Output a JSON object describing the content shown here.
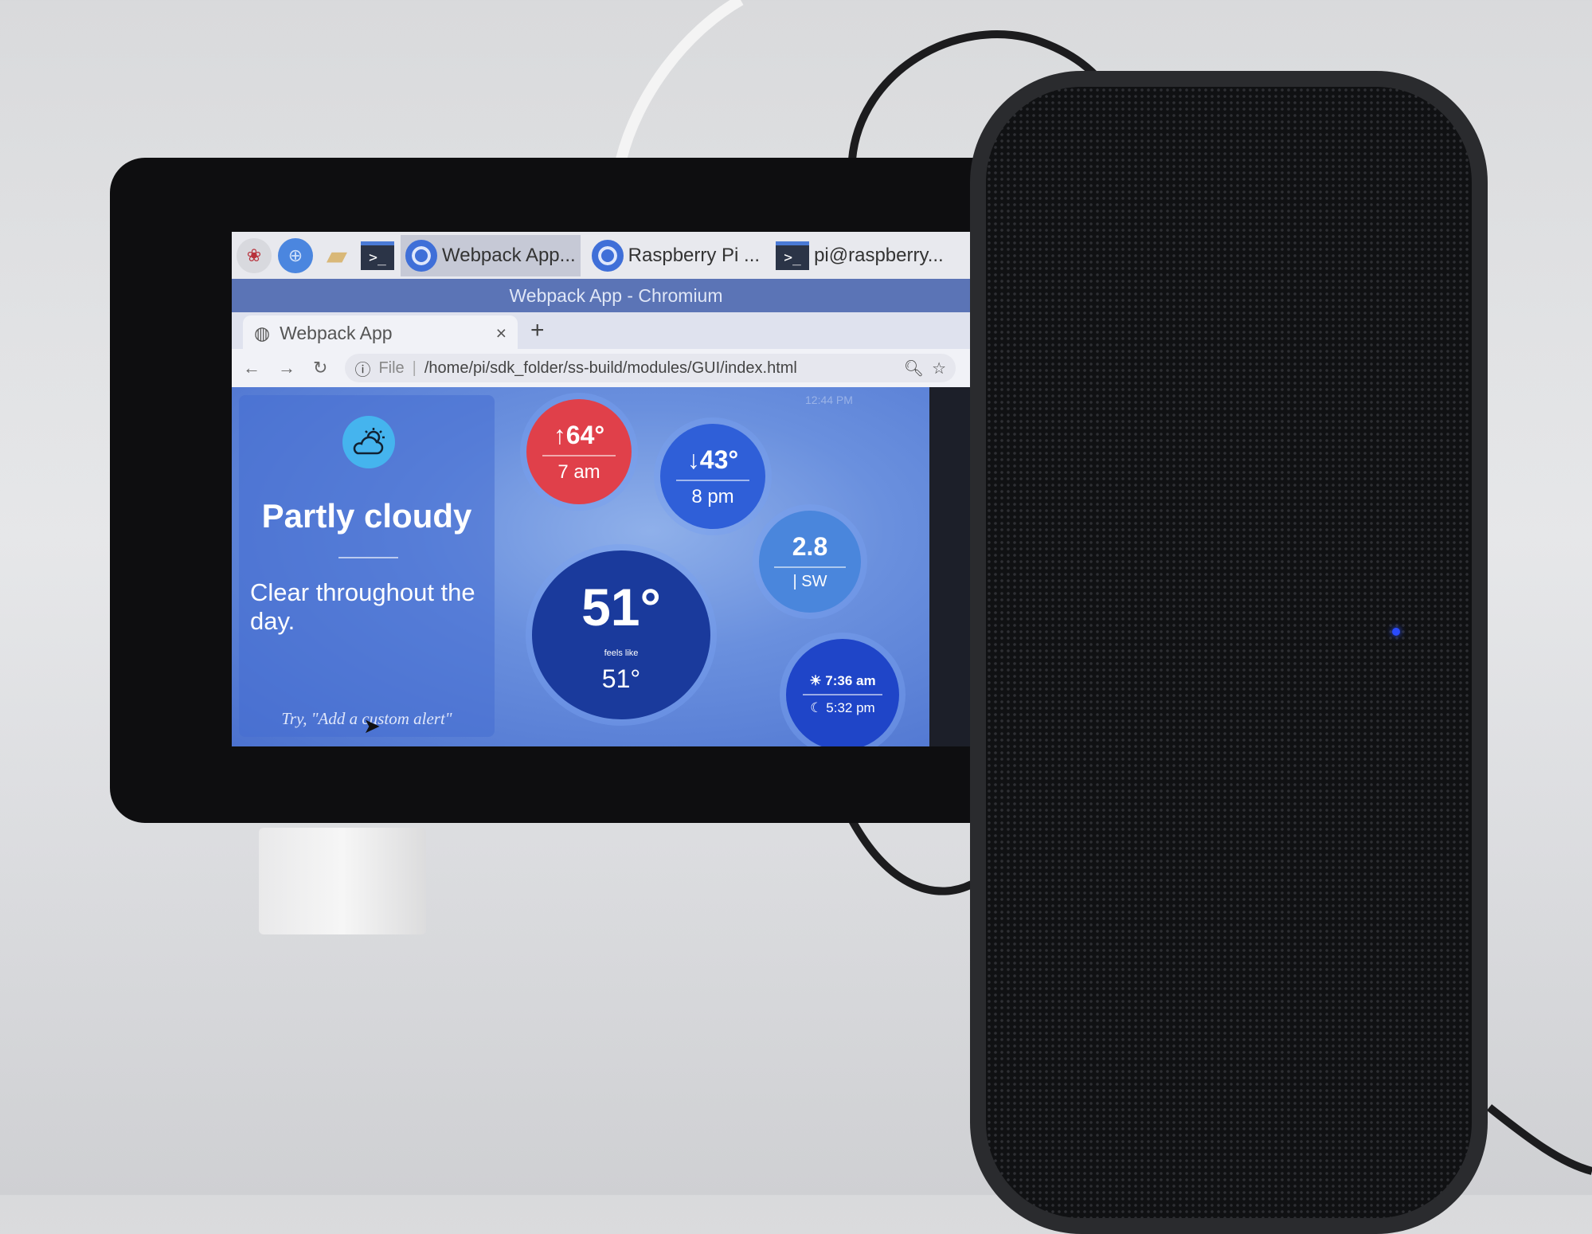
{
  "taskbar": {
    "tasks": [
      {
        "label": "Webpack App...",
        "icon": "chromium-icon",
        "active": true
      },
      {
        "label": "Raspberry Pi ...",
        "icon": "chromium-icon"
      },
      {
        "label": "pi@raspberry...",
        "icon": "terminal-icon"
      }
    ],
    "terminal_glyph": ">_"
  },
  "window": {
    "title": "Webpack App - Chromium"
  },
  "browser": {
    "tab_label": "Webpack App",
    "close": "×",
    "new_tab": "+",
    "scheme_label": "File",
    "url": "/home/pi/sdk_folder/ss-build/modules/GUI/index.html"
  },
  "weather": {
    "clock": "12:44 PM",
    "condition": "Partly cloudy",
    "description": "Clear throughout the day.",
    "hint": "Try, \"Add a custom alert\"",
    "high": {
      "value": "↑64°",
      "time": "7 am",
      "color": "#e0404a"
    },
    "low": {
      "value": "↓43°",
      "time": "8 pm",
      "color": "#2f5fd8"
    },
    "wind": {
      "speed": "2.8",
      "direction": "| SW",
      "color": "#4a86dc"
    },
    "current": {
      "temp": "51°",
      "feels_label": "feels like",
      "feels": "51°",
      "color": "#1a3a9c"
    },
    "sun": {
      "sunrise": "☀ 7:36 am",
      "sunset": "☾ 5:32 pm",
      "color": "#1f45c8"
    }
  }
}
